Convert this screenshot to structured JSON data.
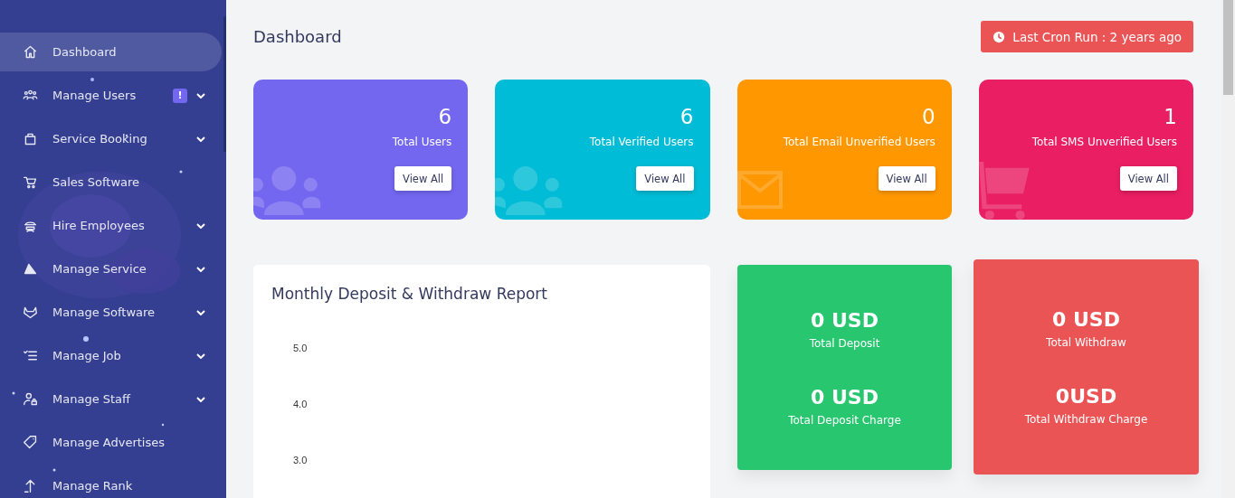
{
  "sidebar": {
    "items": [
      {
        "label": "Dashboard",
        "selected": true,
        "expandable": false
      },
      {
        "label": "Manage Users",
        "selected": false,
        "expandable": true,
        "badge": "!"
      },
      {
        "label": "Service Booking",
        "selected": false,
        "expandable": true
      },
      {
        "label": "Sales Software",
        "selected": false,
        "expandable": false
      },
      {
        "label": "Hire Employees",
        "selected": false,
        "expandable": true
      },
      {
        "label": "Manage Service",
        "selected": false,
        "expandable": true
      },
      {
        "label": "Manage Software",
        "selected": false,
        "expandable": true
      },
      {
        "label": "Manage Job",
        "selected": false,
        "expandable": true
      },
      {
        "label": "Manage Staff",
        "selected": false,
        "expandable": true
      },
      {
        "label": "Manage Advertises",
        "selected": false,
        "expandable": false
      },
      {
        "label": "Manage Rank",
        "selected": false,
        "expandable": false
      }
    ]
  },
  "header": {
    "title": "Dashboard",
    "cron_button": "Last Cron Run : 2 years ago"
  },
  "stat_cards": [
    {
      "value": "6",
      "label": "Total Users",
      "button": "View All",
      "color": "#7367f0"
    },
    {
      "value": "6",
      "label": "Total Verified Users",
      "button": "View All",
      "color": "#00bcd6"
    },
    {
      "value": "0",
      "label": "Total Email Unverified Users",
      "button": "View All",
      "color": "#ff9800"
    },
    {
      "value": "1",
      "label": "Total SMS Unverified Users",
      "button": "View All",
      "color": "#e91e63"
    }
  ],
  "report": {
    "title": "Monthly Deposit & Withdraw Report",
    "y_labels": [
      "5.0",
      "4.0",
      "3.0"
    ]
  },
  "money_cards": [
    {
      "color": "#28c76f",
      "raised": false,
      "items": [
        {
          "value": "0 USD",
          "label": "Total Deposit"
        },
        {
          "value": "0 USD",
          "label": "Total Deposit Charge"
        }
      ]
    },
    {
      "color": "#ea5455",
      "raised": true,
      "items": [
        {
          "value": "0 USD",
          "label": "Total Withdraw"
        },
        {
          "value": "0USD",
          "label": "Total Withdraw Charge"
        }
      ]
    }
  ]
}
